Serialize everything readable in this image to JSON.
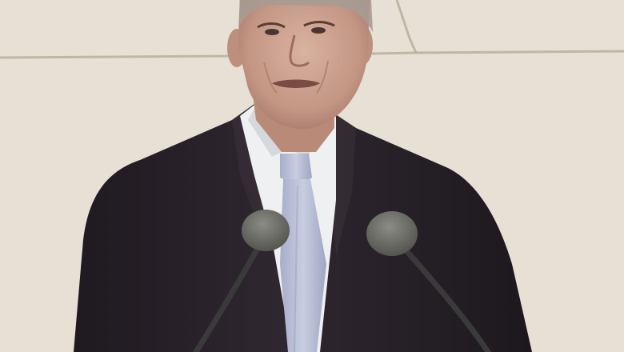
{
  "scene": {
    "wall_color": "#e7e0d4",
    "wall_joint_color": "#b7ab97",
    "suit_color": "#2b232b",
    "shirt_color": "#eef0f1",
    "tie_color": "#b9bfd6",
    "skin_color": "#c79b86",
    "hair_color": "#a79b92",
    "microphone_color": "#6f6f6b",
    "mic_stand_color": "#3a3a3a"
  }
}
